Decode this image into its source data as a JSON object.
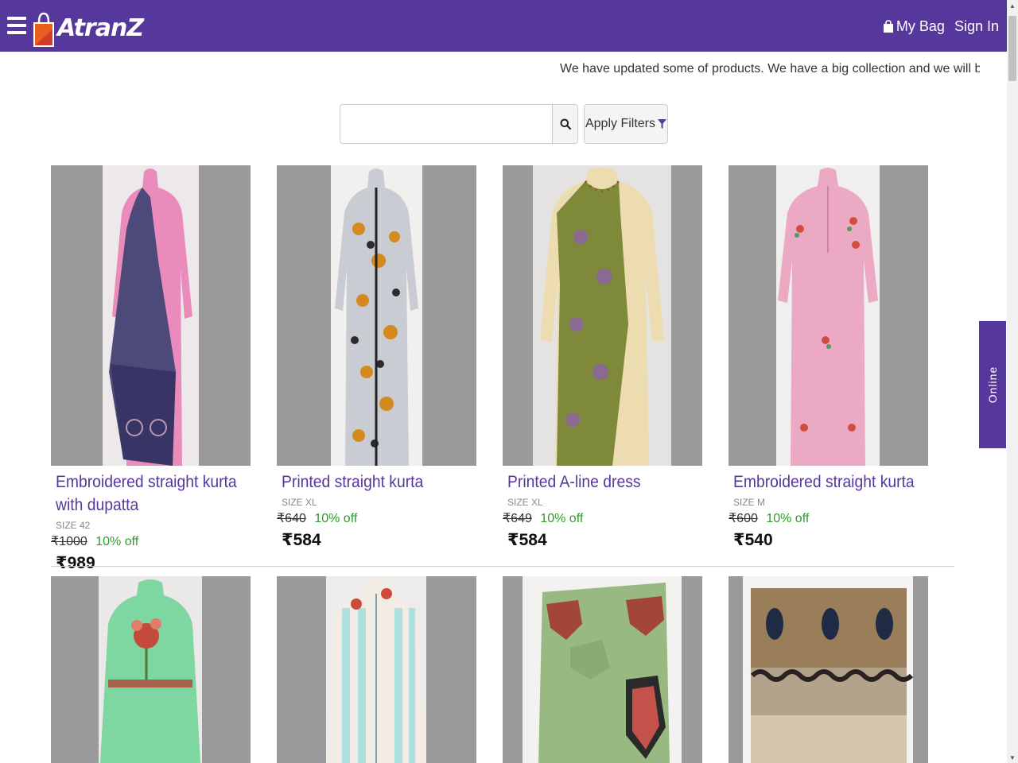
{
  "header": {
    "logo_text": "AtranZ",
    "my_bag_label": "My Bag",
    "sign_in_label": "Sign In"
  },
  "announcement": "We have updated some of products. We have a big collection and we will be updating ma",
  "search": {
    "placeholder": ""
  },
  "filters": {
    "apply_label": "Apply Filters"
  },
  "side_tab": {
    "label": "Online"
  },
  "colors": {
    "brand": "#56379b",
    "discount": "#2e9b2e",
    "image_bg": "#9a9a9a"
  },
  "products": [
    {
      "title": "Embroidered straight kurta with dupatta",
      "size": "SIZE 42",
      "old_price": "₹1000",
      "discount": "10% off",
      "price": "₹989"
    },
    {
      "title": "Printed straight kurta",
      "size": "SIZE XL",
      "old_price": "₹640",
      "discount": "10% off",
      "price": "₹584"
    },
    {
      "title": "Printed A-line dress",
      "size": "SIZE XL",
      "old_price": "₹649",
      "discount": "10% off",
      "price": "₹584"
    },
    {
      "title": "Embroidered straight kurta",
      "size": "SIZE M",
      "old_price": "₹600",
      "discount": "10% off",
      "price": "₹540"
    }
  ]
}
